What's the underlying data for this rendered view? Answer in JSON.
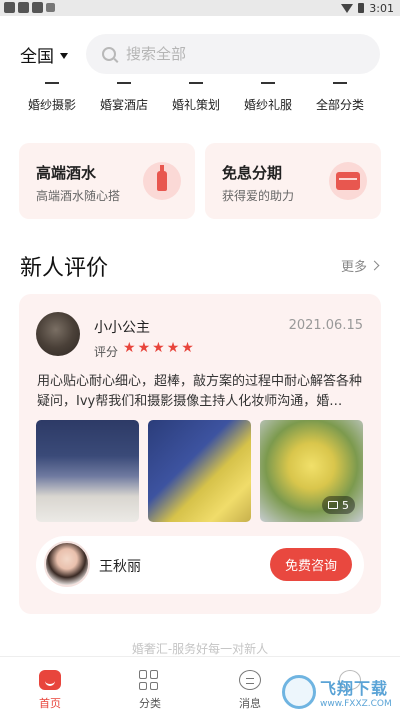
{
  "status_bar": {
    "time": "3:01"
  },
  "header": {
    "region": "全国",
    "search_placeholder": "搜索全部"
  },
  "categories": [
    {
      "label": "婚纱摄影",
      "icon": "camera-icon"
    },
    {
      "label": "婚宴酒店",
      "icon": "hotel-icon"
    },
    {
      "label": "婚礼策划",
      "icon": "planning-icon"
    },
    {
      "label": "婚纱礼服",
      "icon": "dress-icon"
    },
    {
      "label": "全部分类",
      "icon": "all-categories-icon"
    }
  ],
  "promos": [
    {
      "title": "高端酒水",
      "subtitle": "高端酒水随心搭",
      "icon": "bottle-icon"
    },
    {
      "title": "免息分期",
      "subtitle": "获得爱的助力",
      "icon": "card-icon"
    }
  ],
  "reviews_section": {
    "title": "新人评价",
    "more": "更多"
  },
  "review": {
    "reviewer": "小小公主",
    "date": "2021.06.15",
    "rating_label": "评分",
    "rating": 5,
    "text": "用心贴心耐心细心，超棒，敲方案的过程中耐心解答各种疑问，Ivy帮我们和摄影摄像主持人化妆师沟通，婚…",
    "photo_count": "5",
    "planner_name": "王秋丽",
    "consult_label": "免费咨询"
  },
  "tagline": "婚奢汇-服务好每一对新人",
  "bottom_nav": [
    {
      "label": "首页",
      "icon": "home-icon",
      "active": true
    },
    {
      "label": "分类",
      "icon": "category-grid-icon",
      "active": false
    },
    {
      "label": "消息",
      "icon": "message-icon",
      "active": false
    },
    {
      "label": "",
      "icon": "user-icon",
      "active": false
    }
  ],
  "watermark": {
    "main": "飞翔下载",
    "sub": "www.FXXZ.COM"
  },
  "colors": {
    "accent": "#e8453c",
    "card_bg": "#fdf2f1",
    "search_bg": "#f3f3f5"
  }
}
